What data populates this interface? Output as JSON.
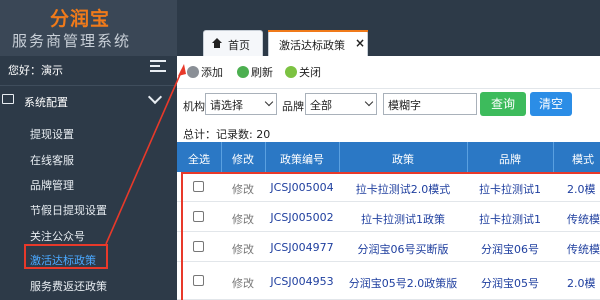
{
  "brand": {
    "name": "分润宝",
    "subtitle": "服务商管理系统"
  },
  "user": {
    "greeting": "您好：演示"
  },
  "sidebar": {
    "section_label": "系统配置",
    "items": [
      {
        "label": "提现设置"
      },
      {
        "label": "在线客服"
      },
      {
        "label": "品牌管理"
      },
      {
        "label": "节假日提现设置"
      },
      {
        "label": "关注公众号"
      },
      {
        "label": "激活达标政策"
      },
      {
        "label": "服务费返还政策"
      }
    ]
  },
  "tabs": [
    {
      "label": "首页"
    },
    {
      "label": "激活达标政策"
    }
  ],
  "toolbar": {
    "add_label": "添加",
    "refresh_label": "刷新",
    "close_label": "关闭"
  },
  "filter": {
    "org_label": "机构",
    "org_value": "请选择",
    "brand_label": "品牌",
    "brand_value": "全部",
    "keyword_value": "模糊字",
    "search_label": "查询",
    "clear_label": "清空"
  },
  "summary": {
    "text": "总计：记录数: 20"
  },
  "table": {
    "headers": [
      "全选",
      "修改",
      "政策编号",
      "政策",
      "品牌",
      "模式"
    ],
    "rows": [
      {
        "edit": "修改",
        "code": "JCSJ005004",
        "policy": "拉卡拉测试2.0模式",
        "brand": "拉卡拉测试1",
        "mode": "2.0模"
      },
      {
        "edit": "修改",
        "code": "JCSJ005002",
        "policy": "拉卡拉测试1政策",
        "brand": "拉卡拉测试1",
        "mode": "传统模"
      },
      {
        "edit": "修改",
        "code": "JCSJ004977",
        "policy": "分润宝06号买断版",
        "brand": "分润宝06号",
        "mode": "传统模"
      },
      {
        "edit": "修改",
        "code": "JCSJ004953",
        "policy": "分润宝05号2.0政策版",
        "brand": "分润宝05号",
        "mode": "2.0模"
      }
    ]
  },
  "colors": {
    "sidebar_bg": "#2d3a48",
    "brand_orange": "#f07a1a",
    "table_header": "#2b78c5",
    "highlight_red": "#e8392a",
    "search_green": "#3dbb5c",
    "clear_blue": "#2b8de6",
    "active_item": "#4aa8ff"
  },
  "icons": {
    "add": "add-user-icon",
    "refresh": "refresh-icon",
    "close": "close-circle-icon",
    "home": "home-icon",
    "section": "monitor-icon",
    "menu": "menu-toggle-icon"
  }
}
